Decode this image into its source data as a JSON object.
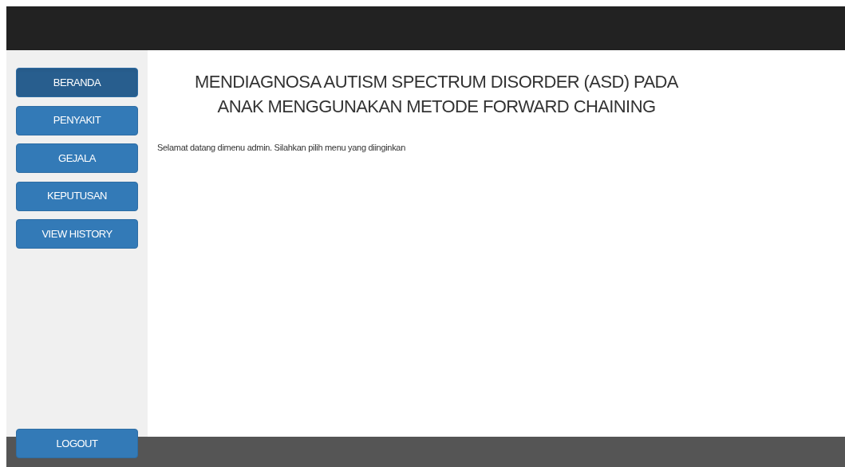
{
  "sidebar": {
    "items": [
      {
        "label": "BERANDA",
        "selected": true
      },
      {
        "label": "PENYAKIT",
        "selected": false
      },
      {
        "label": "GEJALA",
        "selected": false
      },
      {
        "label": "KEPUTUSAN",
        "selected": false
      },
      {
        "label": "VIEW HISTORY",
        "selected": false
      }
    ],
    "logout": "LOGOUT"
  },
  "main": {
    "title_lines": [
      "MENDIAGNOSA AUTISM SPECTRUM DISORDER (ASD) PADA",
      "ANAK MENGGUNAKAN METODE FORWARD CHAINING"
    ],
    "welcome": "Selamat datang dimenu admin. Silahkan pilih menu yang diinginkan"
  }
}
